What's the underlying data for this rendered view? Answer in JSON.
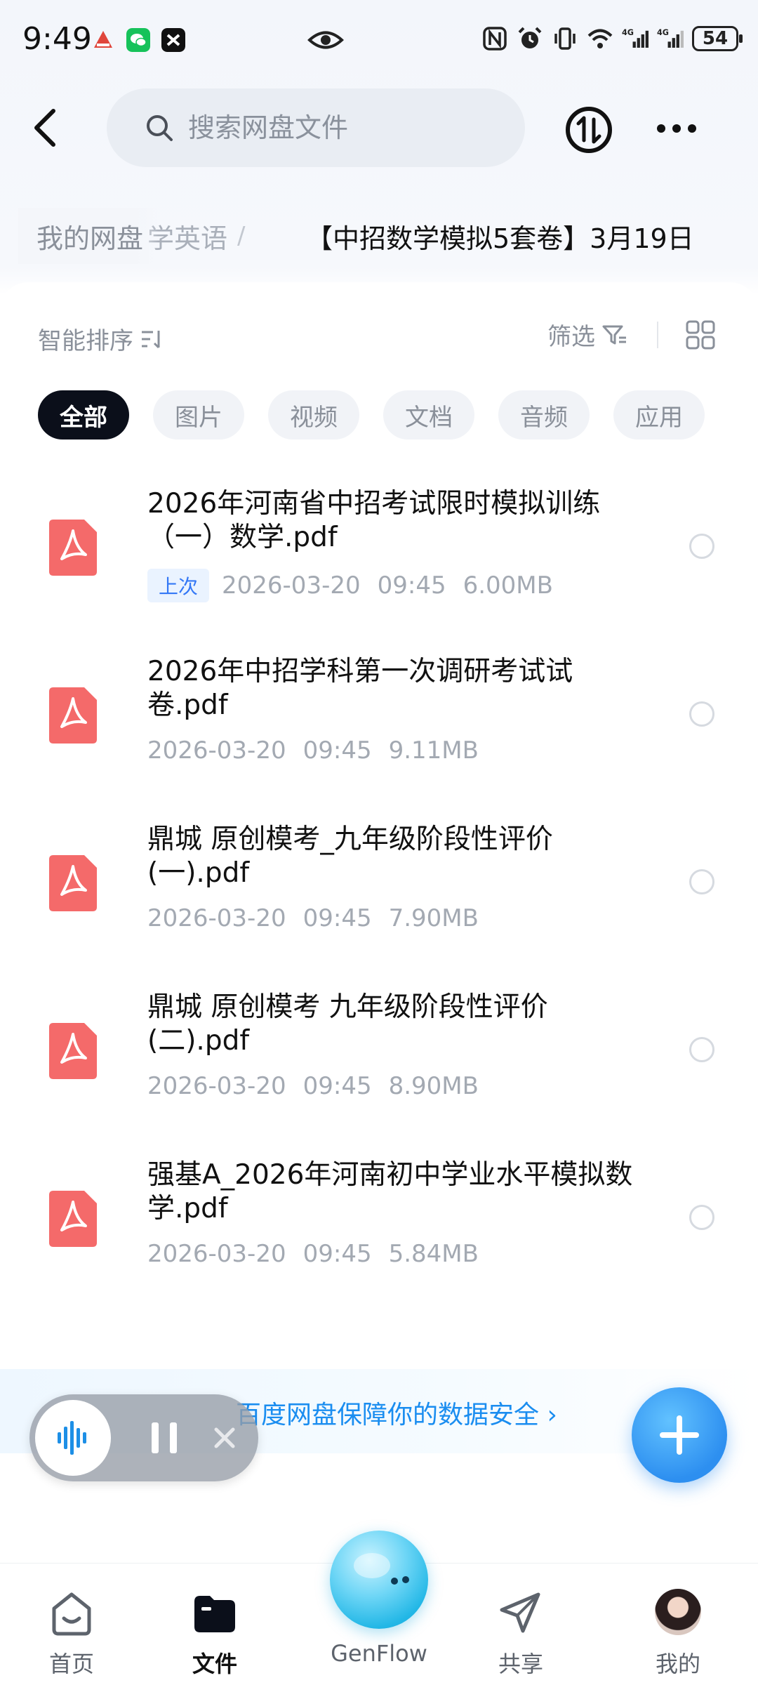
{
  "status_bar": {
    "time": "9:49",
    "network_1": "4G",
    "network_2": "4G",
    "battery": "54"
  },
  "header": {
    "search_placeholder": "搜索网盘文件"
  },
  "breadcrumb": {
    "root": "我的网盘",
    "middle": "学英语",
    "separator": "/",
    "current": "【中招数学模拟5套卷】3月19日"
  },
  "toolbar": {
    "sort_label": "智能排序",
    "filter_label": "筛选"
  },
  "filter_chips": [
    {
      "label": "全部",
      "active": true
    },
    {
      "label": "图片",
      "active": false
    },
    {
      "label": "视频",
      "active": false
    },
    {
      "label": "文档",
      "active": false
    },
    {
      "label": "音频",
      "active": false
    },
    {
      "label": "应用",
      "active": false
    }
  ],
  "files": [
    {
      "name": "2026年河南省中招考试限时模拟训练（一）数学.pdf",
      "badge": "上次",
      "date": "2026-03-20",
      "time": "09:45",
      "size": "6.00MB"
    },
    {
      "name": "2026年中招学科第一次调研考试试卷.pdf",
      "badge": "",
      "date": "2026-03-20",
      "time": "09:45",
      "size": "9.11MB"
    },
    {
      "name": "鼎城 原创模考_九年级阶段性评价(一).pdf",
      "badge": "",
      "date": "2026-03-20",
      "time": "09:45",
      "size": "7.90MB"
    },
    {
      "name": "鼎城 原创模考 九年级阶段性评价(二).pdf",
      "badge": "",
      "date": "2026-03-20",
      "time": "09:45",
      "size": "8.90MB"
    },
    {
      "name": "强基A_2026年河南初中学业水平模拟数学.pdf",
      "badge": "",
      "date": "2026-03-20",
      "time": "09:45",
      "size": "5.84MB"
    }
  ],
  "promo": {
    "text": "百度网盘保障你的数据安全 ›"
  },
  "bottom_nav": {
    "home": "首页",
    "files": "文件",
    "genflow": "GenFlow",
    "share": "共享",
    "mine": "我的"
  },
  "colors": {
    "accent": "#2d8ff0",
    "pdf_red": "#f46a6a",
    "chip_active_bg": "#0b0f1a",
    "badge_blue": "#3478f6"
  },
  "icons": {
    "back": "chevron-left-icon",
    "search": "search-icon",
    "transfer": "transfer-icon",
    "more": "more-horizontal-icon",
    "file": "pdf-file-icon",
    "fab": "plus-icon"
  }
}
